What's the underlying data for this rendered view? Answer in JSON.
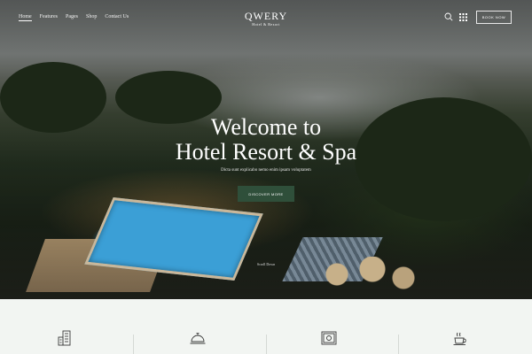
{
  "nav": {
    "items": [
      "Home",
      "Features",
      "Pages",
      "Shop",
      "Contact Us"
    ],
    "active": "Home",
    "book_label": "BOOK NOW"
  },
  "brand": {
    "name": "QWERY",
    "tagline": "Hotel & Resort"
  },
  "hero": {
    "title_line1": "Welcome to",
    "title_line2": "Hotel Resort & Spa",
    "subtitle": "Dicta sunt explicabo nemo enim ipsam voluptatem",
    "cta_label": "DISCOVER MORE",
    "scroll_label": "Scroll Down"
  },
  "features": {
    "icons": [
      "hotel-building-icon",
      "room-service-bell-icon",
      "safe-box-icon",
      "coffee-cup-icon"
    ]
  },
  "colors": {
    "accent": "#2f4f3a",
    "features_bg": "#f2f5f2",
    "icon": "#3a3a3a"
  }
}
